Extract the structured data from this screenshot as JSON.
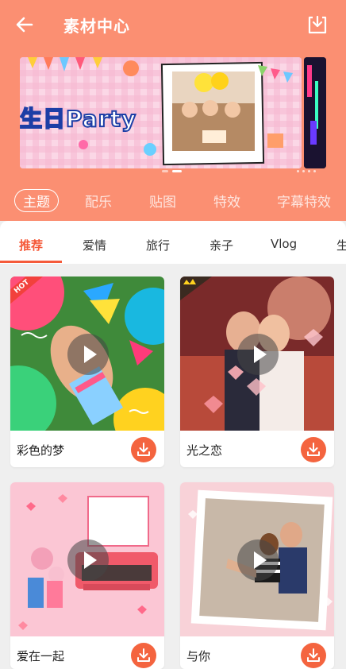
{
  "header": {
    "title": "素材中心",
    "back_icon": "back-arrow-icon",
    "download_icon": "download-tray-icon"
  },
  "banner": {
    "text": "生日Party",
    "page_count": 2,
    "active_index": 1
  },
  "category_tabs": [
    {
      "label": "主题",
      "active": true
    },
    {
      "label": "配乐",
      "active": false
    },
    {
      "label": "贴图",
      "active": false
    },
    {
      "label": "特效",
      "active": false
    },
    {
      "label": "字幕特效",
      "active": false
    }
  ],
  "sub_tabs": [
    {
      "label": "推荐",
      "active": true
    },
    {
      "label": "爱情",
      "active": false
    },
    {
      "label": "旅行",
      "active": false
    },
    {
      "label": "亲子",
      "active": false
    },
    {
      "label": "Vlog",
      "active": false
    },
    {
      "label": "生",
      "active": false
    }
  ],
  "cards": [
    {
      "name": "彩色的梦",
      "badge": "HOT"
    },
    {
      "name": "光之恋",
      "badge": ""
    },
    {
      "name": "爱在一起",
      "badge": ""
    },
    {
      "name": "与你",
      "badge": ""
    }
  ],
  "colors": {
    "header_bg": "#fb8f72",
    "accent": "#f55a3a",
    "download_button": "#f4643f"
  }
}
